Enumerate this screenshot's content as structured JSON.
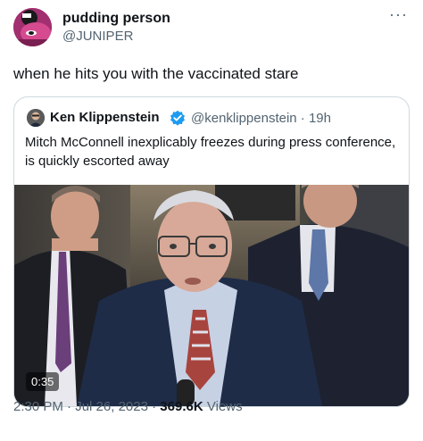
{
  "author": {
    "name": "pudding person",
    "handle": "@JUNIPER",
    "avatar_icon": "cartoon-avatar-icon",
    "avatar_color": "#a22f70"
  },
  "more_icon": "more-options-icon",
  "more_label": "···",
  "tweet_text": "when he hits you with the vaccinated stare",
  "quote": {
    "name": "Ken Klippenstein",
    "verified_icon": "verified-badge-icon",
    "verified_color": "#1d9bf0",
    "handle": "@kenklippenstein · 19h",
    "text": "Mitch McConnell inexplicably freezes during press conference, is quickly escorted away",
    "video_duration": "0:35"
  },
  "meta": {
    "time": "2:30 PM",
    "date": "Jul 26, 2023",
    "views_count": "369.6K",
    "views_label": "Views",
    "sep": " · "
  }
}
